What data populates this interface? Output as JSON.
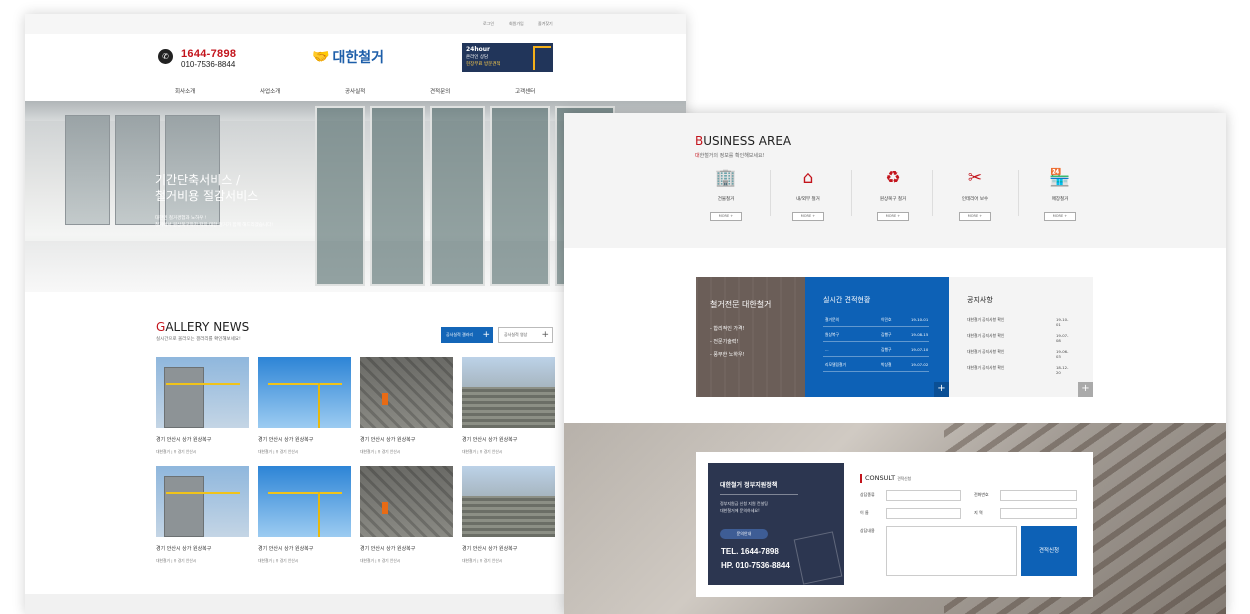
{
  "left_page": {
    "util_links": [
      "로그인",
      "회원가입",
      "즐겨찾기"
    ],
    "header": {
      "phone_main": "1644-7898",
      "phone_sub": "010-7536-8844",
      "logo_text": "대한철거",
      "banner": {
        "line1": "24hour",
        "line2": "온라인 상담",
        "line3": "현장무료 방문견적"
      }
    },
    "nav": [
      "회사소개",
      "사업소개",
      "공사실적",
      "견적문의",
      "고객센터"
    ],
    "hero": {
      "headline1": "기간단축서비스 /",
      "headline2": "철거비용 절감서비스",
      "sub1": "대한민 철거경험과 노하우 !",
      "sub2": "철거에서 원상복구까지 저희 대한 철거가 함께 해드리겠습니다!"
    },
    "gallery": {
      "title_first": "G",
      "title_rest": "ALLERY NEWS",
      "subtitle": "실시간으로 올라오는 갤러리를 확인해보세요!",
      "btn_primary": "공사실적 갤러리",
      "btn_secondary": "공사실적 영상",
      "items": [
        {
          "caption": "경기 안산시 상가 원상복구",
          "company": "대한철거",
          "location": "경기 안산시"
        },
        {
          "caption": "경기 안산시 상가 원상복구",
          "company": "대한철거",
          "location": "경기 안산시"
        },
        {
          "caption": "경기 안산시 상가 원상복구",
          "company": "대한철거",
          "location": "경기 안산시"
        },
        {
          "caption": "경기 안산시 상가 원상복구",
          "company": "대한철거",
          "location": "경기 안산시"
        },
        {
          "caption": "경기 안산시 상가 원상복구",
          "company": "대한철거",
          "location": "경기 안산시"
        },
        {
          "caption": "경기 안산시 상가 원상복구",
          "company": "대한철거",
          "location": "경기 안산시"
        },
        {
          "caption": "경기 안산시 상가 원상복구",
          "company": "대한철거",
          "location": "경기 안산시"
        },
        {
          "caption": "경기 안산시 상가 원상복구",
          "company": "대한철거",
          "location": "경기 안산시"
        }
      ]
    }
  },
  "right_page": {
    "business": {
      "title_first": "B",
      "title_rest": "USINESS AREA",
      "subtitle_first": "대",
      "subtitle_rest": "한철거의 정보를 확인해보세요!",
      "more_label": "MORE +",
      "items": [
        {
          "label": "건물철거",
          "icon": "building-icon"
        },
        {
          "label": "내/외부 철거",
          "icon": "house-search-icon"
        },
        {
          "label": "원상복구 철거",
          "icon": "recycle-icon"
        },
        {
          "label": "인테리어 보수",
          "icon": "tools-icon"
        },
        {
          "label": "매장철거",
          "icon": "store-icon"
        }
      ]
    },
    "promo": {
      "title": "철거전문 대한철거",
      "points": [
        "- 합리적인 가격!",
        "- 전문기술력!",
        "- 풍부한 노하우!"
      ]
    },
    "estimates": {
      "title": "실시간 견적현황",
      "rows": [
        {
          "type": "철거문의",
          "name": "이민호",
          "date": "19-10-01"
        },
        {
          "type": "원상복구",
          "name": "김행구",
          "date": "19-08-15"
        },
        {
          "type": "...",
          "name": "김행구",
          "date": "19-07-10"
        },
        {
          "type": "리모델링철거",
          "name": "박상철",
          "date": "19-07-02"
        }
      ],
      "plus": "+"
    },
    "notice": {
      "title": "공지사항",
      "rows": [
        {
          "text": "대한철거 공지사항 확인",
          "date": "19-10-01"
        },
        {
          "text": "대한철거 공지사항 확인",
          "date": "19-07-08"
        },
        {
          "text": "대한철거 공지사항 확인",
          "date": "19-06-03"
        },
        {
          "text": "대한철거 공지사항 확인",
          "date": "18-12-20"
        }
      ],
      "plus": "+"
    },
    "consult": {
      "panel_title": "대한철거 정부지원정책",
      "panel_desc1": "정부지원금 신청 지원 컨설팅",
      "panel_desc2": "대한철거에 문의하세요!",
      "panel_btn": "문의안내",
      "tel": "TEL.  1644-7898",
      "hp": "HP.   010-7536-8844",
      "form_title": "CONSULT",
      "form_subtitle": "견적신청",
      "labels": {
        "category": "상담종류",
        "phone": "전화번호",
        "name": "이   름",
        "region": "지   역",
        "content": "상담내용"
      },
      "submit": "견적신청"
    }
  }
}
